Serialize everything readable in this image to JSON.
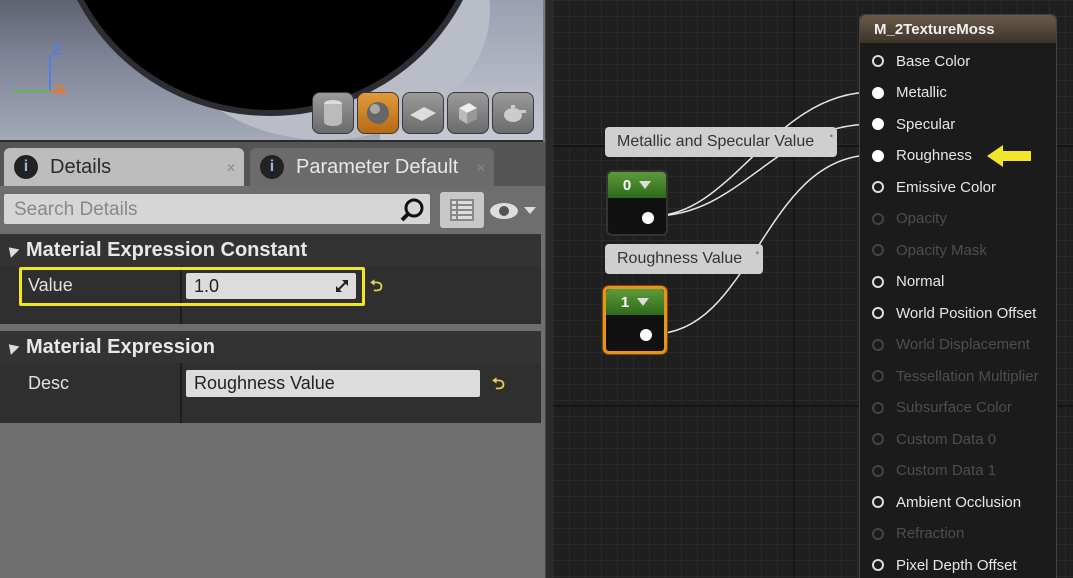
{
  "viewport": {
    "axis_z": "Z",
    "axis_x": "X",
    "toolbar": [
      "cylinder-icon",
      "sphere-icon",
      "plane-icon",
      "cube-icon",
      "teapot-icon"
    ]
  },
  "tabs": [
    {
      "label": "Details",
      "active": true
    },
    {
      "label": "Parameter Default",
      "active": false
    }
  ],
  "search": {
    "placeholder": "Search Details"
  },
  "sections": {
    "constant": {
      "title": "Material Expression Constant",
      "value_label": "Value",
      "value": "1.0"
    },
    "expression": {
      "title": "Material Expression",
      "desc_label": "Desc",
      "desc_value": "Roughness Value"
    }
  },
  "graph": {
    "comments": {
      "metallic": "Metallic and Specular Value",
      "roughness": "Roughness Value"
    },
    "const_nodes": {
      "metallic_value": "0",
      "roughness_value": "1"
    },
    "material": {
      "title": "M_2TextureMoss",
      "pins": [
        {
          "label": "Base Color",
          "enabled": true,
          "connected": false
        },
        {
          "label": "Metallic",
          "enabled": true,
          "connected": true
        },
        {
          "label": "Specular",
          "enabled": true,
          "connected": true
        },
        {
          "label": "Roughness",
          "enabled": true,
          "connected": true
        },
        {
          "label": "Emissive Color",
          "enabled": true,
          "connected": false
        },
        {
          "label": "Opacity",
          "enabled": false,
          "connected": false
        },
        {
          "label": "Opacity Mask",
          "enabled": false,
          "connected": false
        },
        {
          "label": "Normal",
          "enabled": true,
          "connected": false
        },
        {
          "label": "World Position Offset",
          "enabled": true,
          "connected": false
        },
        {
          "label": "World Displacement",
          "enabled": false,
          "connected": false
        },
        {
          "label": "Tessellation Multiplier",
          "enabled": false,
          "connected": false
        },
        {
          "label": "Subsurface Color",
          "enabled": false,
          "connected": false
        },
        {
          "label": "Custom Data 0",
          "enabled": false,
          "connected": false
        },
        {
          "label": "Custom Data 1",
          "enabled": false,
          "connected": false
        },
        {
          "label": "Ambient Occlusion",
          "enabled": true,
          "connected": false
        },
        {
          "label": "Refraction",
          "enabled": false,
          "connected": false
        },
        {
          "label": "Pixel Depth Offset",
          "enabled": true,
          "connected": false
        }
      ]
    },
    "highlight_color": "#f2e62a",
    "selection_color": "#e8941c"
  }
}
